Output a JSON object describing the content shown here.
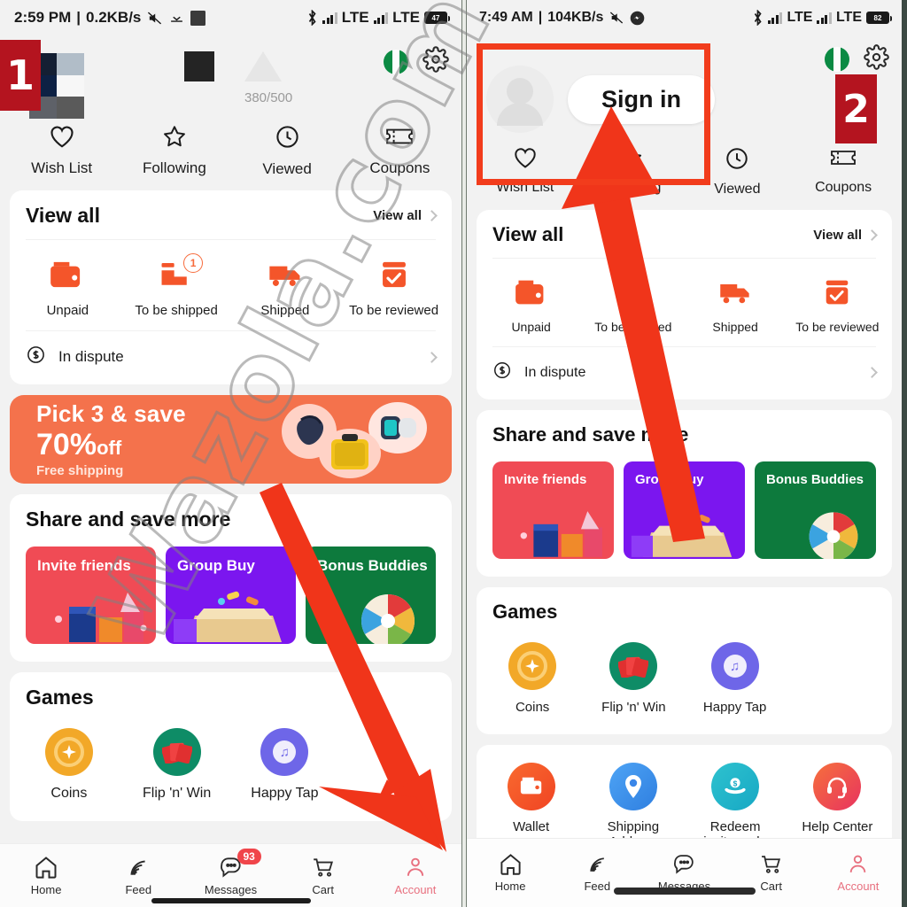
{
  "annotations": {
    "step1": "1",
    "step2": "2",
    "watermark": "Wazola.com",
    "highlight_color": "#f23c1c",
    "badge_color": "#b4141f",
    "arrow_color": "#f0351a"
  },
  "left": {
    "status": {
      "time": "2:59 PM",
      "separator": "|",
      "net_speed": "0.2KB/s",
      "mute_icon": "mute-icon",
      "call_icon": "missed-call-icon",
      "square_icon": "square-icon",
      "bluetooth_icon": "bluetooth-icon",
      "lte1": "LTE",
      "lte2": "LTE",
      "battery": "47"
    },
    "header": {
      "flag_icon": "nigeria-flag-icon",
      "settings_icon": "gear-icon"
    },
    "profile": {
      "ratio": "380/500"
    },
    "quick_links": [
      {
        "label": "Wish List",
        "icon": "heart-icon"
      },
      {
        "label": "Following",
        "icon": "star-icon"
      },
      {
        "label": "Viewed",
        "icon": "clock-icon"
      },
      {
        "label": "Coupons",
        "icon": "ticket-icon"
      }
    ],
    "orders_card": {
      "title": "View all",
      "more_label": "View all",
      "items": [
        {
          "label": "Unpaid",
          "icon": "wallet-icon",
          "badge": ""
        },
        {
          "label": "To be shipped",
          "icon": "package-icon",
          "badge": "1"
        },
        {
          "label": "Shipped",
          "icon": "truck-icon",
          "badge": ""
        },
        {
          "label": "To be reviewed",
          "icon": "review-check-icon",
          "badge": ""
        }
      ],
      "dispute_label": "In dispute",
      "dispute_icon": "dollar-refund-icon"
    },
    "promo": {
      "line1": "Pick 3 & save",
      "line2_main": "70%",
      "line2_sub": "off",
      "line3": "Free shipping"
    },
    "share_card": {
      "title": "Share and save more",
      "tiles": [
        {
          "label": "Invite friends",
          "color": "#f04b55"
        },
        {
          "label": "Group Buy",
          "color": "#7b16ef"
        },
        {
          "label": "Bonus Buddies",
          "color": "#0d7a3d"
        }
      ]
    },
    "games_card": {
      "title": "Games",
      "items": [
        {
          "label": "Coins",
          "icon": "coin-icon"
        },
        {
          "label": "Flip 'n' Win",
          "icon": "cards-icon"
        },
        {
          "label": "Happy Tap",
          "icon": "music-note-icon"
        }
      ]
    },
    "nav": [
      {
        "label": "Home",
        "icon": "home-icon",
        "badge": ""
      },
      {
        "label": "Feed",
        "icon": "feed-icon",
        "badge": ""
      },
      {
        "label": "Messages",
        "icon": "chat-icon",
        "badge": "93"
      },
      {
        "label": "Cart",
        "icon": "cart-icon",
        "badge": ""
      },
      {
        "label": "Account",
        "icon": "person-icon",
        "badge": ""
      }
    ]
  },
  "right": {
    "status": {
      "time": "7:49 AM",
      "separator": "|",
      "net_speed": "104KB/s",
      "mute_icon": "mute-icon",
      "messenger_icon": "messenger-icon",
      "bluetooth_icon": "bluetooth-icon",
      "lte1": "LTE",
      "lte2": "LTE",
      "battery": "82"
    },
    "header": {
      "flag_icon": "nigeria-flag-icon",
      "settings_icon": "gear-icon"
    },
    "profile": {
      "sign_in_label": "Sign in",
      "avatar_icon": "default-avatar-icon"
    },
    "quick_links": [
      {
        "label": "Wish List",
        "icon": "heart-icon"
      },
      {
        "label": "Following",
        "icon": "star-icon"
      },
      {
        "label": "Viewed",
        "icon": "clock-icon"
      },
      {
        "label": "Coupons",
        "icon": "ticket-icon"
      }
    ],
    "orders_card": {
      "title": "View all",
      "more_label": "View all",
      "items": [
        {
          "label": "Unpaid",
          "icon": "wallet-icon"
        },
        {
          "label": "To be shipped",
          "icon": "package-icon"
        },
        {
          "label": "Shipped",
          "icon": "truck-icon"
        },
        {
          "label": "To be reviewed",
          "icon": "review-check-icon"
        }
      ],
      "dispute_label": "In dispute",
      "dispute_icon": "dollar-refund-icon"
    },
    "share_card": {
      "title": "Share and save more",
      "tiles": [
        {
          "label": "Invite friends",
          "color": "#f04b55"
        },
        {
          "label": "Group Buy",
          "color": "#7b16ef"
        },
        {
          "label": "Bonus Buddies",
          "color": "#0d7a3d"
        }
      ]
    },
    "games_card": {
      "title": "Games",
      "items": [
        {
          "label": "Coins",
          "icon": "coin-icon"
        },
        {
          "label": "Flip 'n' Win",
          "icon": "cards-icon"
        },
        {
          "label": "Happy Tap",
          "icon": "music-note-icon"
        }
      ]
    },
    "services_card": {
      "items": [
        {
          "label": "Wallet",
          "icon": "wallet-circle-icon"
        },
        {
          "label": "Shipping Address",
          "icon": "location-pin-icon"
        },
        {
          "label": "Redeem invite code",
          "icon": "hand-money-icon"
        },
        {
          "label": "Help Center",
          "icon": "headset-icon"
        }
      ]
    },
    "nav": [
      {
        "label": "Home",
        "icon": "home-icon"
      },
      {
        "label": "Feed",
        "icon": "feed-icon"
      },
      {
        "label": "Messages",
        "icon": "chat-icon"
      },
      {
        "label": "Cart",
        "icon": "cart-icon"
      },
      {
        "label": "Account",
        "icon": "person-icon"
      }
    ]
  }
}
